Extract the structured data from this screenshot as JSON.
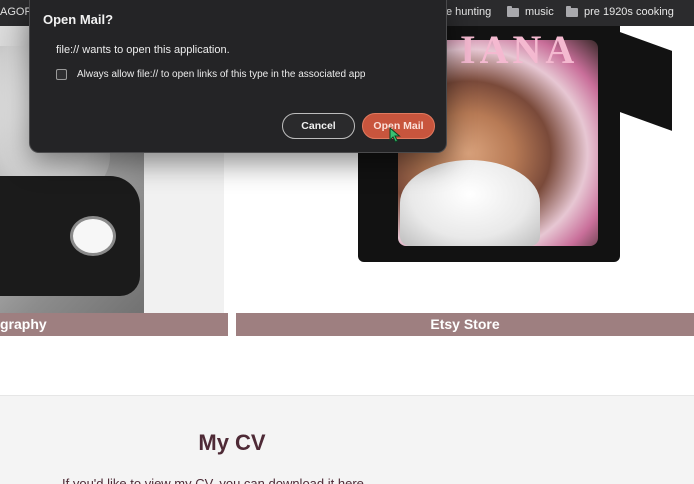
{
  "bookmarks": {
    "items": [
      {
        "label": "AGORA"
      },
      {
        "label": "e hunting"
      },
      {
        "label": "music",
        "icon": "folder-icon"
      },
      {
        "label": "pre 1920s cooking",
        "icon": "folder-icon"
      }
    ]
  },
  "gallery": {
    "left_label": "graphy",
    "right_label": "Etsy Store",
    "print_text": "IANA"
  },
  "cv": {
    "title": "My CV",
    "text": "If you'd like to view my CV, you can download it here"
  },
  "dialog": {
    "title": "Open Mail?",
    "message": "file:// wants to open this application.",
    "checkbox_label": "Always allow file:// to open links of this type in the associated app",
    "checkbox_checked": false,
    "cancel_label": "Cancel",
    "open_label": "Open Mail"
  },
  "colors": {
    "label_bar": "#9e7f80",
    "cv_title": "#4e2a36",
    "open_button": "#c8553d"
  }
}
